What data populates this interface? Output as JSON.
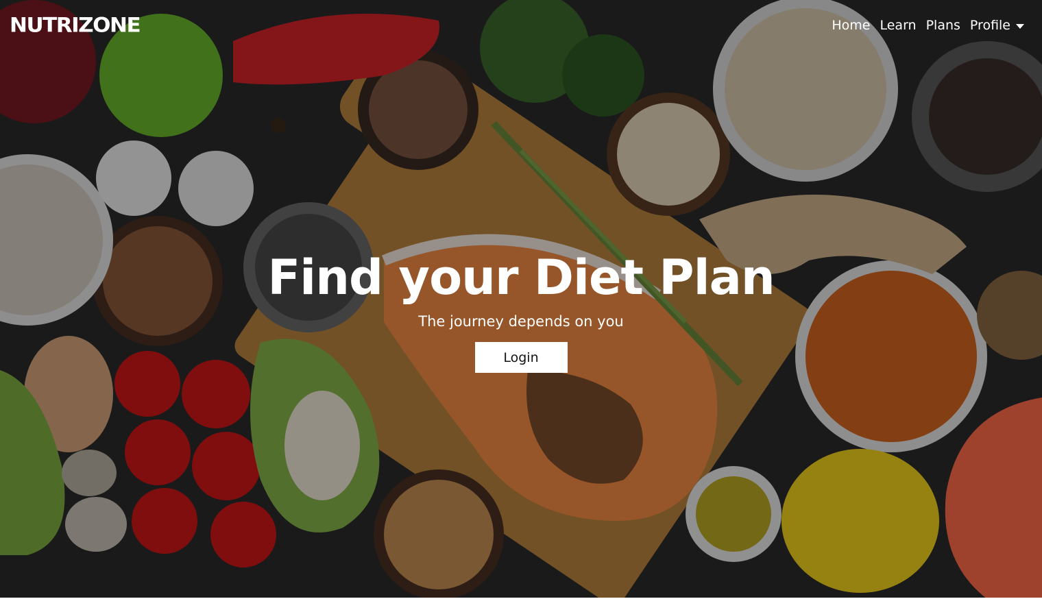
{
  "brand": {
    "logo_text": "NUTRIZONE"
  },
  "nav": {
    "items": [
      {
        "label": "Home"
      },
      {
        "label": "Learn"
      },
      {
        "label": "Plans"
      },
      {
        "label": "Profile"
      }
    ],
    "profile_icon": "chevron-down-icon"
  },
  "hero": {
    "title": "Find your Diet Plan",
    "subtitle": "The journey depends on you",
    "login_label": "Login",
    "background_image": "healthy-food-flatlay"
  },
  "colors": {
    "text": "#ffffff",
    "button_bg": "#ffffff",
    "button_text": "#111111",
    "overlay": "rgba(0,0,0,0.38)"
  }
}
